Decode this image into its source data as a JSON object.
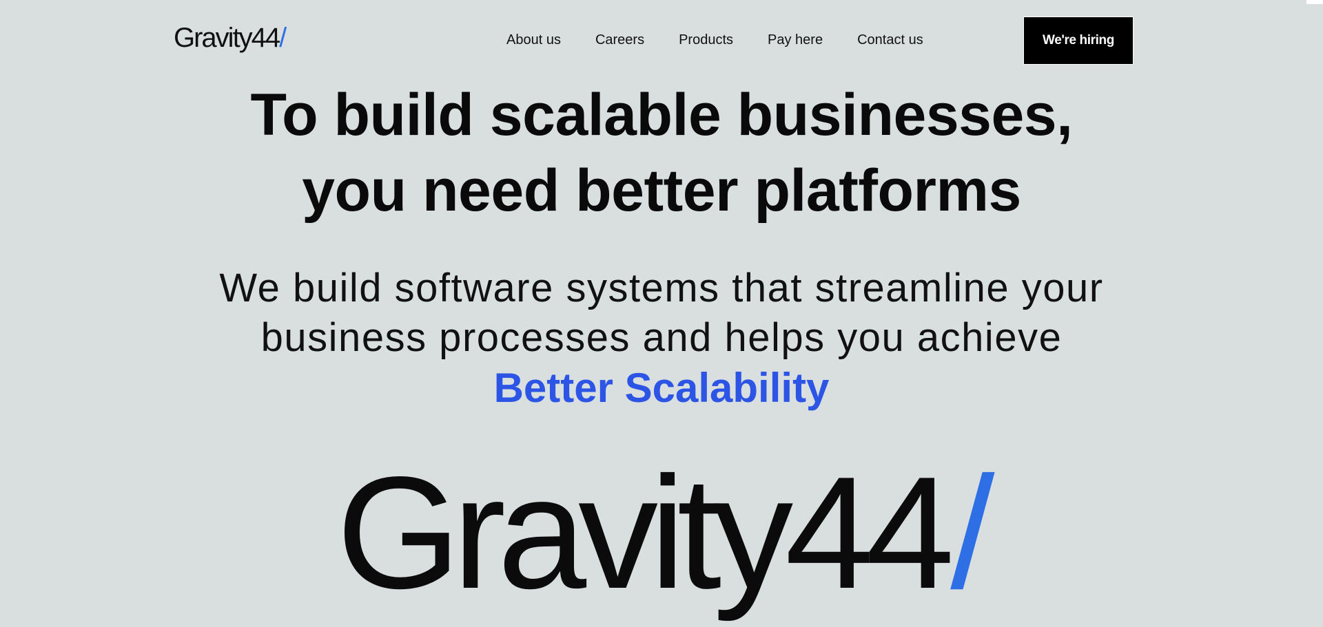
{
  "header": {
    "logo": {
      "text": "Gravity44",
      "slash": "/"
    },
    "nav": [
      {
        "label": "About us"
      },
      {
        "label": "Careers"
      },
      {
        "label": "Products"
      },
      {
        "label": "Pay here"
      },
      {
        "label": "Contact us"
      }
    ],
    "cta_label": "We're hiring"
  },
  "hero": {
    "headline_line1": "To build scalable businesses,",
    "headline_line2": "you need better platforms",
    "sub_line1": "We build software systems that streamline your",
    "sub_line2": "business processes and helps you achieve",
    "accent": "Better Scalability"
  },
  "big_logo": {
    "text": "Gravity44",
    "slash": "/"
  },
  "colors": {
    "background": "#d9dfdf",
    "accent_blue": "#2c55e6",
    "logo_slash_blue": "#2f6fe6",
    "button_bg": "#000000",
    "button_text": "#ffffff"
  }
}
